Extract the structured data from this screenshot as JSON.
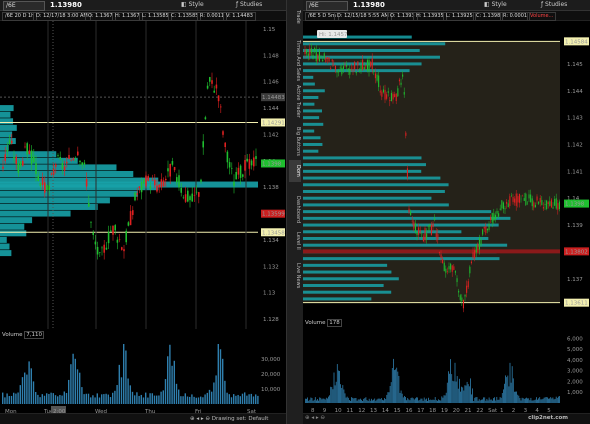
{
  "left": {
    "symbol": "/6E",
    "price": "1.13980",
    "style_label": "Style",
    "studies_label": "Studies",
    "stats": [
      {
        "label": "/6E 20 D 1h",
        "red": false
      },
      {
        "label": "D: 12/17/18 3:00 AM",
        "red": false
      },
      {
        "label": "O: 1.1367",
        "red": false
      },
      {
        "label": "H: 1.1367",
        "red": false
      },
      {
        "label": "L: 1.13585",
        "red": false
      },
      {
        "label": "C: 1.13585",
        "red": false
      },
      {
        "label": "R: 0.0011",
        "red": false
      },
      {
        "label": "V: 1.14483",
        "red": false
      }
    ],
    "y_ticks": [
      "1.15",
      "1.148",
      "1.146",
      "1.144",
      "1.142",
      "1.14",
      "1.138",
      "1.136",
      "1.134",
      "1.132",
      "1.13",
      "1.128"
    ],
    "price_tags": [
      {
        "text": "1.14483",
        "bg": "#3c3c3c",
        "fg": "#dddddd"
      },
      {
        "text": "1.14291",
        "bg": "#f3f0b0",
        "fg": "#000000"
      },
      {
        "text": "1.1398",
        "bg": "#1fbf2f",
        "fg": "#000000"
      },
      {
        "text": "1.13599",
        "bg": "#cc1f1f",
        "fg": "#ffffff"
      },
      {
        "text": "1.13458",
        "bg": "#f3f0b0",
        "fg": "#000000"
      }
    ],
    "volume_label": "Volume",
    "volume_value": "7,110",
    "vol_ticks": [
      "30,000",
      "20,000",
      "10,000"
    ],
    "x_labels": [
      "Mon",
      "Tue",
      "Wed",
      "Thu",
      "Fri",
      "Sat"
    ],
    "cursor_label": "2:00"
  },
  "right": {
    "symbol": "/6E",
    "price": "1.13980",
    "style_label": "Style",
    "studies_label": "Studies",
    "stats": [
      {
        "label": "/6E 5 D 5m",
        "red": false
      },
      {
        "label": "D: 12/15/18 5:55 AM",
        "red": false
      },
      {
        "label": "O: 1.1393",
        "red": false
      },
      {
        "label": "H: 1.13935",
        "red": false
      },
      {
        "label": "L: 1.13925",
        "red": false
      },
      {
        "label": "C: 1.1398",
        "red": false
      },
      {
        "label": "R: 0.0001",
        "red": false
      },
      {
        "label": "Volume...",
        "red": true
      }
    ],
    "hi_label": "Hi: 1.1457",
    "y_ticks": [
      "1.145",
      "1.144",
      "1.143",
      "1.142",
      "1.141",
      "1.14",
      "1.139",
      "1.138",
      "1.137"
    ],
    "price_tags": [
      {
        "text": "1.14584",
        "bg": "#f3f0b0",
        "fg": "#000000"
      },
      {
        "text": "1.1398",
        "bg": "#1fbf2f",
        "fg": "#000000"
      },
      {
        "text": "1.13802",
        "bg": "#cc1f1f",
        "fg": "#ffffff"
      },
      {
        "text": "1.13611",
        "bg": "#f3f0b0",
        "fg": "#000000"
      }
    ],
    "volume_label": "Volume",
    "volume_value": "178",
    "vol_ticks": [
      "6,000",
      "5,000",
      "4,000",
      "3,000",
      "2,000",
      "1,000"
    ],
    "x_labels": [
      "8",
      "9",
      "10",
      "11",
      "12",
      "13",
      "14",
      "15",
      "16",
      "17",
      "18",
      "19",
      "20",
      "21",
      "22",
      "Sat",
      "1",
      "2",
      "3",
      "4",
      "5"
    ]
  },
  "sidebar": {
    "tabs": [
      "Trade",
      "Times And Sales",
      "Active Trader",
      "Big Buttons",
      "Dom",
      "Dashboard",
      "Level II",
      "Live News"
    ],
    "active_tab": "Dom"
  },
  "footer": {
    "drawing_set": "Drawing set: Default"
  },
  "watermark": "clip2net.com",
  "colors": {
    "up": "#1fbf2f",
    "down": "#e02020",
    "profile": "#17a2a8",
    "poc": "#8b1a1a",
    "level_line": "#f3f0b0"
  }
}
